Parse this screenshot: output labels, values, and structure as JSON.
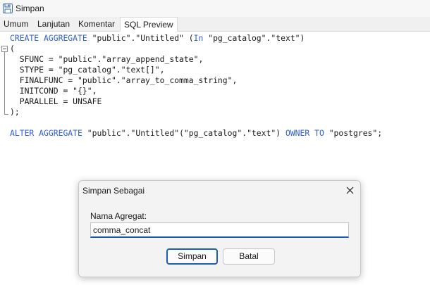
{
  "toolbar": {
    "save_label": "Simpan"
  },
  "tabs": [
    {
      "label": "Umum"
    },
    {
      "label": "Lanjutan"
    },
    {
      "label": "Komentar"
    },
    {
      "label": "SQL Preview",
      "active": true
    }
  ],
  "sql": {
    "lines": [
      "CREATE AGGREGATE \"public\".\"Untitled\" (In \"pg_catalog\".\"text\")",
      "(",
      "  SFUNC = \"public\".\"array_append_state\",",
      "  STYPE = \"pg_catalog\".\"text[]\",",
      "  FINALFUNC = \"public\".\"array_to_comma_string\",",
      "  INITCOND = \"{}\",",
      "  PARALLEL = UNSAFE",
      ");",
      "",
      "ALTER AGGREGATE \"public\".\"Untitled\"(\"pg_catalog\".\"text\") OWNER TO \"postgres\";"
    ],
    "keywords": [
      "CREATE",
      "AGGREGATE",
      "In",
      "ALTER",
      "OWNER",
      "TO"
    ]
  },
  "dialog": {
    "title": "Simpan Sebagai",
    "field_label": "Nama Agregat:",
    "field_value": "comma_concat",
    "ok_label": "Simpan",
    "cancel_label": "Batal"
  },
  "colors": {
    "keyword": "#2f5fd0",
    "accent": "#1a5fb4"
  }
}
